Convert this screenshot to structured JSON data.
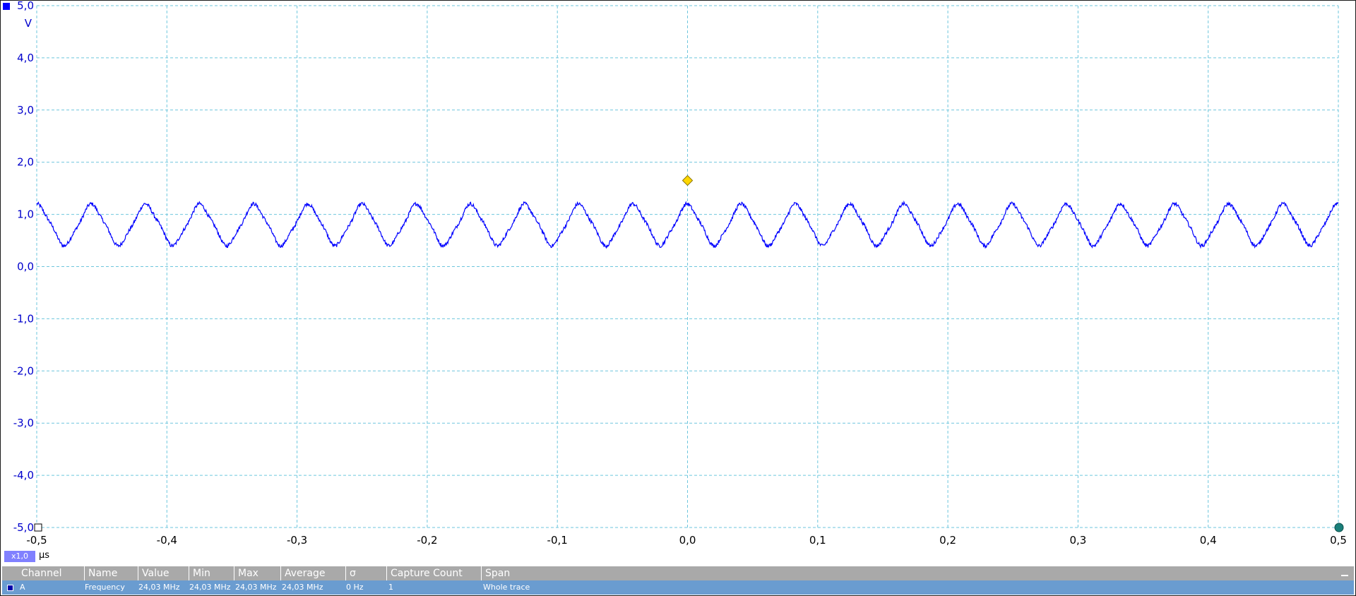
{
  "chart_data": {
    "type": "line",
    "title": "",
    "xlabel": "µs",
    "ylabel": "V",
    "xlim": [
      -0.5,
      0.5
    ],
    "ylim": [
      -5.0,
      5.0
    ],
    "grid": true,
    "y_ticks": [
      "5,0",
      "4,0",
      "3,0",
      "2,0",
      "1,0",
      "0,0",
      "-1,0",
      "-2,0",
      "-3,0",
      "-4,0",
      "-5,0"
    ],
    "y_tick_values": [
      5,
      4,
      3,
      2,
      1,
      0,
      -1,
      -2,
      -3,
      -4,
      -5
    ],
    "x_ticks": [
      "-0,5",
      "-0,4",
      "-0,3",
      "-0,2",
      "-0,1",
      "0,0",
      "0,1",
      "0,2",
      "0,3",
      "0,4",
      "0,5"
    ],
    "x_tick_values": [
      -0.5,
      -0.4,
      -0.3,
      -0.2,
      -0.1,
      0,
      0.1,
      0.2,
      0.3,
      0.4,
      0.5
    ],
    "series": [
      {
        "channel": "A",
        "color": "#0000ff",
        "waveform": "sine",
        "frequency_mhz": 24.03,
        "offset_v": 0.8,
        "amplitude_v": 0.37,
        "peak_x_us": 0.0
      }
    ],
    "trigger": {
      "x": 0.0,
      "y": 1.65,
      "color": "#ffd700"
    }
  },
  "x_scale_badge": "x1,0",
  "x_unit": "µs",
  "measurements": {
    "headers": [
      "Channel",
      "Name",
      "Value",
      "Min",
      "Max",
      "Average",
      "σ",
      "Capture Count",
      "Span"
    ],
    "rows": [
      [
        "A",
        "Frequency",
        "24,03 MHz",
        "24,03 MHz",
        "24,03 MHz",
        "24,03 MHz",
        "0 Hz",
        "1",
        "Whole trace"
      ]
    ]
  },
  "colors": {
    "grid": "#6ec6dd",
    "trace": "#0000ff",
    "header_bg": "#a9a9a9",
    "row_bg": "#6a9cd0"
  }
}
